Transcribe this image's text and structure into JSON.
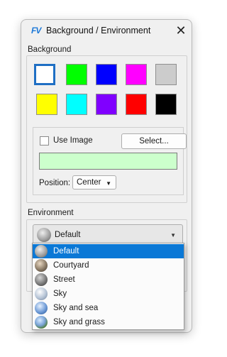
{
  "window": {
    "app_icon": "FV",
    "title": "Background / Environment",
    "close_glyph": "✕"
  },
  "background": {
    "section_label": "Background",
    "swatches": [
      {
        "name": "white",
        "color": "#ffffff",
        "selected": true
      },
      {
        "name": "green",
        "color": "#00ff00",
        "selected": false
      },
      {
        "name": "blue",
        "color": "#0000ff",
        "selected": false
      },
      {
        "name": "magenta",
        "color": "#ff00ff",
        "selected": false
      },
      {
        "name": "light-gray",
        "color": "#cccccc",
        "selected": false
      },
      {
        "name": "yellow",
        "color": "#ffff00",
        "selected": false
      },
      {
        "name": "cyan",
        "color": "#00ffff",
        "selected": false
      },
      {
        "name": "purple",
        "color": "#8000ff",
        "selected": false
      },
      {
        "name": "red",
        "color": "#ff0000",
        "selected": false
      },
      {
        "name": "black",
        "color": "#000000",
        "selected": false
      }
    ],
    "use_image_label": "Use Image",
    "use_image_checked": false,
    "select_button_label": "Select...",
    "image_color": "#ccffcc",
    "position_label": "Position:",
    "position_value": "Center"
  },
  "environment": {
    "section_label": "Environment",
    "selected": "Default",
    "options": [
      {
        "label": "Default",
        "icon": "default-env-sphere-icon"
      },
      {
        "label": "Courtyard",
        "icon": "courtyard-env-sphere-icon"
      },
      {
        "label": "Street",
        "icon": "street-env-sphere-icon"
      },
      {
        "label": "Sky",
        "icon": "sky-env-sphere-icon"
      },
      {
        "label": "Sky and sea",
        "icon": "sky-and-sea-env-sphere-icon"
      },
      {
        "label": "Sky and grass",
        "icon": "sky-and-grass-env-sphere-icon"
      }
    ]
  },
  "colors": {
    "accent": "#0a78d6"
  }
}
